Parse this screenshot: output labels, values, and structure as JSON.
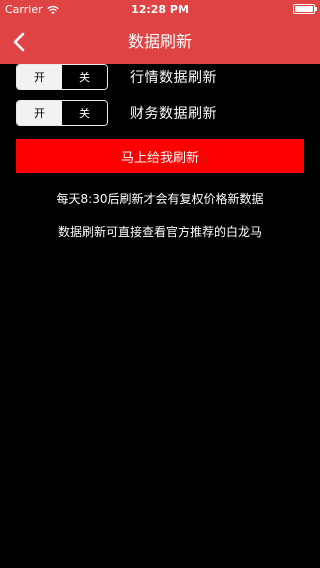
{
  "status_bar": {
    "carrier": "Carrier",
    "time": "12:28 PM",
    "battery_level": 1.0,
    "wifi_icon": "wifi-icon"
  },
  "nav": {
    "title": "数据刷新",
    "back_icon": "chevron-left-icon"
  },
  "toggles": [
    {
      "on_label": "开",
      "off_label": "关",
      "label": "行情数据刷新"
    },
    {
      "on_label": "开",
      "off_label": "关",
      "label": "财务数据刷新"
    }
  ],
  "refresh_button": {
    "label": "马上给我刷新"
  },
  "notes": {
    "line1": "每天8:30后刷新才会有复权价格新数据",
    "line2": "数据刷新可直接查看官方推荐的白龙马"
  },
  "colors": {
    "nav_background": "#e04343",
    "button_background": "#ff0000"
  }
}
